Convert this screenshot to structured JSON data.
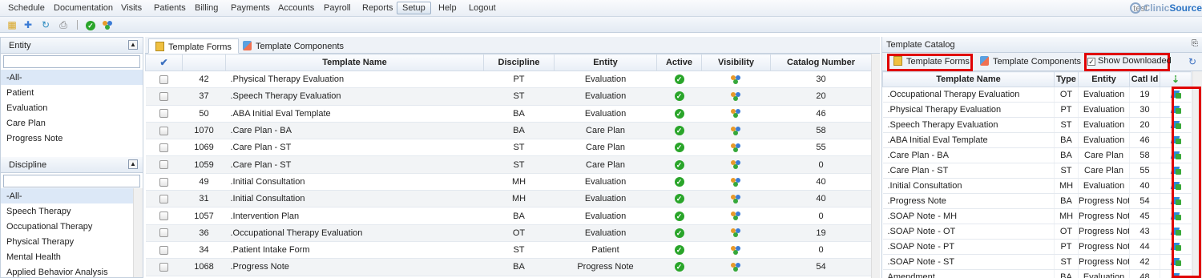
{
  "menu": {
    "items": [
      "Schedule",
      "Documentation",
      "Visits",
      "Patients",
      "Billing",
      "Payments",
      "Accounts",
      "Payroll",
      "Reports",
      "Setup",
      "Help",
      "Logout"
    ],
    "active": "Setup",
    "user": "test",
    "logo_pre": "Clinic",
    "logo_post": "Source"
  },
  "toolbar": {
    "icons": [
      "add-form-icon",
      "add-component-icon",
      "refresh-doc-icon",
      "print-icon",
      "approve-icon",
      "users-icon"
    ]
  },
  "left": {
    "entity_header": "Entity",
    "entity_items": [
      "-All-",
      "Patient",
      "Evaluation",
      "Care Plan",
      "Progress Note"
    ],
    "discipline_header": "Discipline",
    "discipline_items": [
      "-All-",
      "Speech Therapy",
      "Occupational Therapy",
      "Physical Therapy",
      "Mental Health",
      "Applied Behavior Analysis"
    ]
  },
  "tabs": {
    "forms": "Template Forms",
    "components": "Template Components"
  },
  "grid": {
    "headers": {
      "name": "Template Name",
      "discipline": "Discipline",
      "entity": "Entity",
      "active": "Active",
      "visibility": "Visibility",
      "catalog": "Catalog Number"
    },
    "rows": [
      {
        "id": "42",
        "name": ".Physical Therapy Evaluation",
        "discipline": "PT",
        "entity": "Evaluation",
        "catalog": "30"
      },
      {
        "id": "37",
        "name": ".Speech Therapy Evaluation",
        "discipline": "ST",
        "entity": "Evaluation",
        "catalog": "20"
      },
      {
        "id": "50",
        "name": ".ABA Initial Eval Template",
        "discipline": "BA",
        "entity": "Evaluation",
        "catalog": "46"
      },
      {
        "id": "1070",
        "name": ".Care Plan - BA",
        "discipline": "BA",
        "entity": "Care Plan",
        "catalog": "58"
      },
      {
        "id": "1069",
        "name": ".Care Plan - ST",
        "discipline": "ST",
        "entity": "Care Plan",
        "catalog": "55"
      },
      {
        "id": "1059",
        "name": ".Care Plan - ST",
        "discipline": "ST",
        "entity": "Care Plan",
        "catalog": "0"
      },
      {
        "id": "49",
        "name": ".Initial Consultation",
        "discipline": "MH",
        "entity": "Evaluation",
        "catalog": "40"
      },
      {
        "id": "31",
        "name": ".Initial Consultation",
        "discipline": "MH",
        "entity": "Evaluation",
        "catalog": "40"
      },
      {
        "id": "1057",
        "name": ".Intervention Plan",
        "discipline": "BA",
        "entity": "Evaluation",
        "catalog": "0"
      },
      {
        "id": "36",
        "name": ".Occupational Therapy Evaluation",
        "discipline": "OT",
        "entity": "Evaluation",
        "catalog": "19"
      },
      {
        "id": "34",
        "name": ".Patient Intake Form",
        "discipline": "ST",
        "entity": "Patient",
        "catalog": "0"
      },
      {
        "id": "1068",
        "name": ".Progress Note",
        "discipline": "BA",
        "entity": "Progress Note",
        "catalog": "54"
      }
    ]
  },
  "catalog": {
    "title": "Template Catalog",
    "tab_forms": "Template Forms",
    "tab_components": "Template Components",
    "show_downloaded": "Show Downloaded",
    "headers": {
      "name": "Template Name",
      "type": "Type",
      "entity": "Entity",
      "catl": "Catl Id"
    },
    "rows": [
      {
        "name": ".Occupational Therapy Evaluation",
        "type": "OT",
        "entity": "Evaluation",
        "catl": "19"
      },
      {
        "name": ".Physical Therapy Evaluation",
        "type": "PT",
        "entity": "Evaluation",
        "catl": "30"
      },
      {
        "name": ".Speech Therapy Evaluation",
        "type": "ST",
        "entity": "Evaluation",
        "catl": "20"
      },
      {
        "name": ".ABA Initial Eval Template",
        "type": "BA",
        "entity": "Evaluation",
        "catl": "46"
      },
      {
        "name": ".Care Plan - BA",
        "type": "BA",
        "entity": "Care Plan",
        "catl": "58"
      },
      {
        "name": ".Care Plan - ST",
        "type": "ST",
        "entity": "Care Plan",
        "catl": "55"
      },
      {
        "name": ".Initial Consultation",
        "type": "MH",
        "entity": "Evaluation",
        "catl": "40"
      },
      {
        "name": ".Progress Note",
        "type": "BA",
        "entity": "Progress Note",
        "catl": "54"
      },
      {
        "name": ".SOAP Note - MH",
        "type": "MH",
        "entity": "Progress Note",
        "catl": "45"
      },
      {
        "name": ".SOAP Note - OT",
        "type": "OT",
        "entity": "Progress Note",
        "catl": "43"
      },
      {
        "name": ".SOAP Note - PT",
        "type": "PT",
        "entity": "Progress Note",
        "catl": "44"
      },
      {
        "name": ".SOAP Note - ST",
        "type": "ST",
        "entity": "Progress Note",
        "catl": "42"
      },
      {
        "name": "Amendment",
        "type": "BA",
        "entity": "Evaluation",
        "catl": "48"
      }
    ]
  },
  "colors": {
    "highlight_box": "#e00000",
    "active_check": "#2aa52a",
    "selected_row": "#dce8f7"
  }
}
